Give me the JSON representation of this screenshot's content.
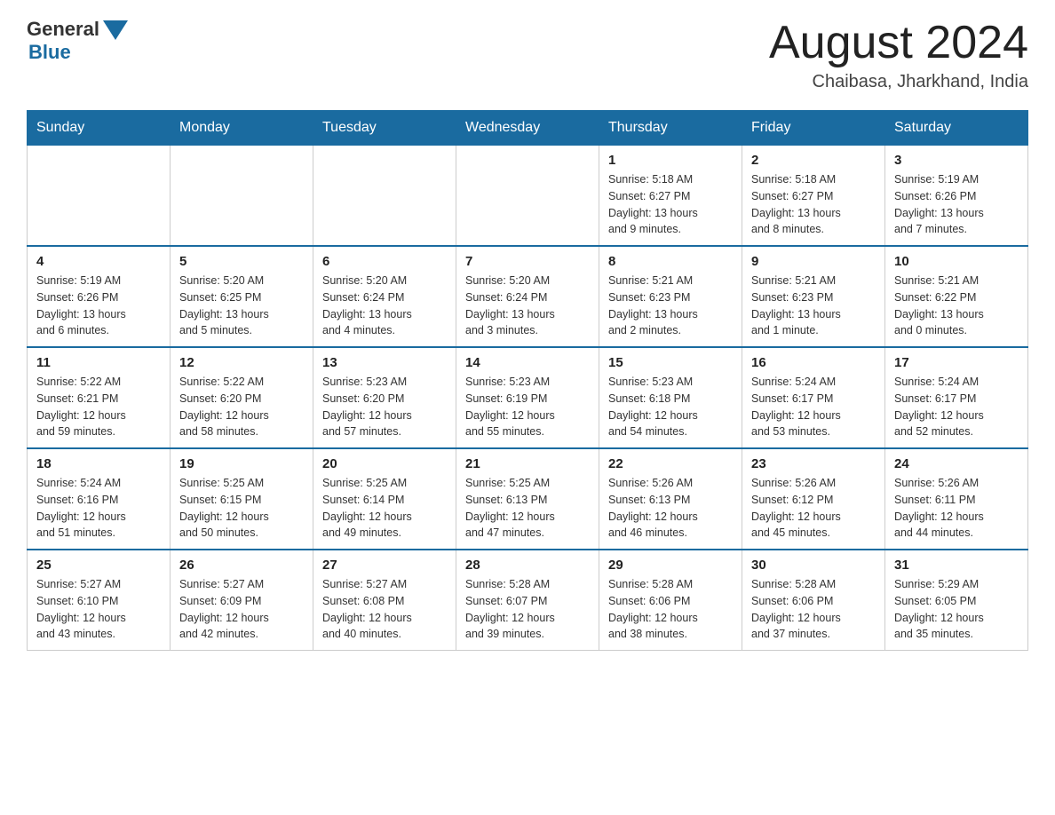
{
  "header": {
    "logo_general": "General",
    "logo_blue": "Blue",
    "title": "August 2024",
    "subtitle": "Chaibasa, Jharkhand, India"
  },
  "weekdays": [
    "Sunday",
    "Monday",
    "Tuesday",
    "Wednesday",
    "Thursday",
    "Friday",
    "Saturday"
  ],
  "weeks": [
    [
      {
        "day": "",
        "info": ""
      },
      {
        "day": "",
        "info": ""
      },
      {
        "day": "",
        "info": ""
      },
      {
        "day": "",
        "info": ""
      },
      {
        "day": "1",
        "info": "Sunrise: 5:18 AM\nSunset: 6:27 PM\nDaylight: 13 hours\nand 9 minutes."
      },
      {
        "day": "2",
        "info": "Sunrise: 5:18 AM\nSunset: 6:27 PM\nDaylight: 13 hours\nand 8 minutes."
      },
      {
        "day": "3",
        "info": "Sunrise: 5:19 AM\nSunset: 6:26 PM\nDaylight: 13 hours\nand 7 minutes."
      }
    ],
    [
      {
        "day": "4",
        "info": "Sunrise: 5:19 AM\nSunset: 6:26 PM\nDaylight: 13 hours\nand 6 minutes."
      },
      {
        "day": "5",
        "info": "Sunrise: 5:20 AM\nSunset: 6:25 PM\nDaylight: 13 hours\nand 5 minutes."
      },
      {
        "day": "6",
        "info": "Sunrise: 5:20 AM\nSunset: 6:24 PM\nDaylight: 13 hours\nand 4 minutes."
      },
      {
        "day": "7",
        "info": "Sunrise: 5:20 AM\nSunset: 6:24 PM\nDaylight: 13 hours\nand 3 minutes."
      },
      {
        "day": "8",
        "info": "Sunrise: 5:21 AM\nSunset: 6:23 PM\nDaylight: 13 hours\nand 2 minutes."
      },
      {
        "day": "9",
        "info": "Sunrise: 5:21 AM\nSunset: 6:23 PM\nDaylight: 13 hours\nand 1 minute."
      },
      {
        "day": "10",
        "info": "Sunrise: 5:21 AM\nSunset: 6:22 PM\nDaylight: 13 hours\nand 0 minutes."
      }
    ],
    [
      {
        "day": "11",
        "info": "Sunrise: 5:22 AM\nSunset: 6:21 PM\nDaylight: 12 hours\nand 59 minutes."
      },
      {
        "day": "12",
        "info": "Sunrise: 5:22 AM\nSunset: 6:20 PM\nDaylight: 12 hours\nand 58 minutes."
      },
      {
        "day": "13",
        "info": "Sunrise: 5:23 AM\nSunset: 6:20 PM\nDaylight: 12 hours\nand 57 minutes."
      },
      {
        "day": "14",
        "info": "Sunrise: 5:23 AM\nSunset: 6:19 PM\nDaylight: 12 hours\nand 55 minutes."
      },
      {
        "day": "15",
        "info": "Sunrise: 5:23 AM\nSunset: 6:18 PM\nDaylight: 12 hours\nand 54 minutes."
      },
      {
        "day": "16",
        "info": "Sunrise: 5:24 AM\nSunset: 6:17 PM\nDaylight: 12 hours\nand 53 minutes."
      },
      {
        "day": "17",
        "info": "Sunrise: 5:24 AM\nSunset: 6:17 PM\nDaylight: 12 hours\nand 52 minutes."
      }
    ],
    [
      {
        "day": "18",
        "info": "Sunrise: 5:24 AM\nSunset: 6:16 PM\nDaylight: 12 hours\nand 51 minutes."
      },
      {
        "day": "19",
        "info": "Sunrise: 5:25 AM\nSunset: 6:15 PM\nDaylight: 12 hours\nand 50 minutes."
      },
      {
        "day": "20",
        "info": "Sunrise: 5:25 AM\nSunset: 6:14 PM\nDaylight: 12 hours\nand 49 minutes."
      },
      {
        "day": "21",
        "info": "Sunrise: 5:25 AM\nSunset: 6:13 PM\nDaylight: 12 hours\nand 47 minutes."
      },
      {
        "day": "22",
        "info": "Sunrise: 5:26 AM\nSunset: 6:13 PM\nDaylight: 12 hours\nand 46 minutes."
      },
      {
        "day": "23",
        "info": "Sunrise: 5:26 AM\nSunset: 6:12 PM\nDaylight: 12 hours\nand 45 minutes."
      },
      {
        "day": "24",
        "info": "Sunrise: 5:26 AM\nSunset: 6:11 PM\nDaylight: 12 hours\nand 44 minutes."
      }
    ],
    [
      {
        "day": "25",
        "info": "Sunrise: 5:27 AM\nSunset: 6:10 PM\nDaylight: 12 hours\nand 43 minutes."
      },
      {
        "day": "26",
        "info": "Sunrise: 5:27 AM\nSunset: 6:09 PM\nDaylight: 12 hours\nand 42 minutes."
      },
      {
        "day": "27",
        "info": "Sunrise: 5:27 AM\nSunset: 6:08 PM\nDaylight: 12 hours\nand 40 minutes."
      },
      {
        "day": "28",
        "info": "Sunrise: 5:28 AM\nSunset: 6:07 PM\nDaylight: 12 hours\nand 39 minutes."
      },
      {
        "day": "29",
        "info": "Sunrise: 5:28 AM\nSunset: 6:06 PM\nDaylight: 12 hours\nand 38 minutes."
      },
      {
        "day": "30",
        "info": "Sunrise: 5:28 AM\nSunset: 6:06 PM\nDaylight: 12 hours\nand 37 minutes."
      },
      {
        "day": "31",
        "info": "Sunrise: 5:29 AM\nSunset: 6:05 PM\nDaylight: 12 hours\nand 35 minutes."
      }
    ]
  ]
}
